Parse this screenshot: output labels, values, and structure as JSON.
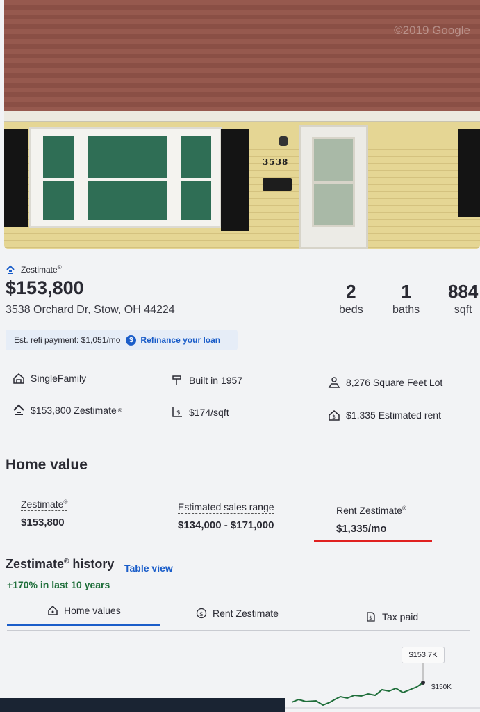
{
  "photo": {
    "house_number": "3538",
    "watermark": "©2019 Google"
  },
  "summary": {
    "zestimate_label": "Zestimate",
    "reg": "®",
    "price": "$153,800",
    "address": "3538 Orchard Dr, Stow, OH 44224",
    "beds_value": "2",
    "beds_label": "beds",
    "baths_value": "1",
    "baths_label": "baths",
    "sqft_value": "884",
    "sqft_label": "sqft"
  },
  "refi": {
    "text": "Est. refi payment: $1,051/mo",
    "icon_glyph": "$",
    "link": "Refinance your loan"
  },
  "facts": {
    "type": "SingleFamily",
    "built": "Built in 1957",
    "lot": "8,276 Square Feet Lot",
    "zestimate": "$153,800 Zestimate",
    "price_per_sqft": "$174/sqft",
    "rent": "$1,335 Estimated rent",
    "icons": [
      "home-icon",
      "hammer-icon",
      "lot-icon",
      "zestimate-icon",
      "price-per-sqft-icon",
      "rent-icon"
    ]
  },
  "home_value": {
    "title": "Home value",
    "zestimate_label": "Zestimate",
    "zestimate_value": "$153,800",
    "range_label": "Estimated sales range",
    "range_value": "$134,000 - $171,000",
    "rent_label": "Rent Zestimate",
    "rent_value": "$1,335/mo"
  },
  "history": {
    "title": "Zestimate",
    "title_suffix": " history",
    "table_view": "Table view",
    "growth": "+170% in last 10 years",
    "tabs": [
      {
        "label": "Home values",
        "active": true
      },
      {
        "label": "Rent Zestimate",
        "active": false
      },
      {
        "label": "Tax paid",
        "active": false
      }
    ],
    "chart_tip": "$153.7K",
    "chart_axis": "$150K"
  },
  "colors": {
    "accent": "#1a5dc9",
    "growth": "#1f6e3a",
    "annotation": "#e02020"
  }
}
